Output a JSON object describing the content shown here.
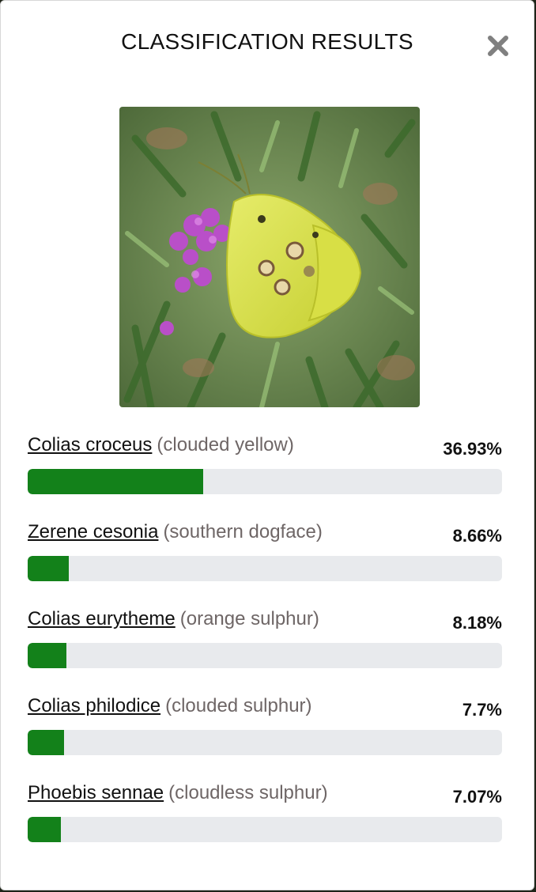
{
  "modal": {
    "title": "CLASSIFICATION RESULTS",
    "close_icon": "close-x-icon"
  },
  "image": {
    "subject": "yellow butterfly on purple flower"
  },
  "results": [
    {
      "scientific": "Colias croceus",
      "common": "(clouded yellow)",
      "percent_label": "36.93%",
      "percent": 36.93
    },
    {
      "scientific": "Zerene cesonia",
      "common": "(southern dogface)",
      "percent_label": "8.66%",
      "percent": 8.66
    },
    {
      "scientific": "Colias eurytheme",
      "common": "(orange sulphur)",
      "percent_label": "8.18%",
      "percent": 8.18
    },
    {
      "scientific": "Colias philodice",
      "common": "(clouded sulphur)",
      "percent_label": "7.7%",
      "percent": 7.7
    },
    {
      "scientific": "Phoebis sennae",
      "common": "(cloudless sulphur)",
      "percent_label": "7.07%",
      "percent": 7.07
    }
  ],
  "colors": {
    "bar_fill": "#13811a",
    "bar_track": "#e8eaed",
    "common_name": "#6e6666"
  }
}
